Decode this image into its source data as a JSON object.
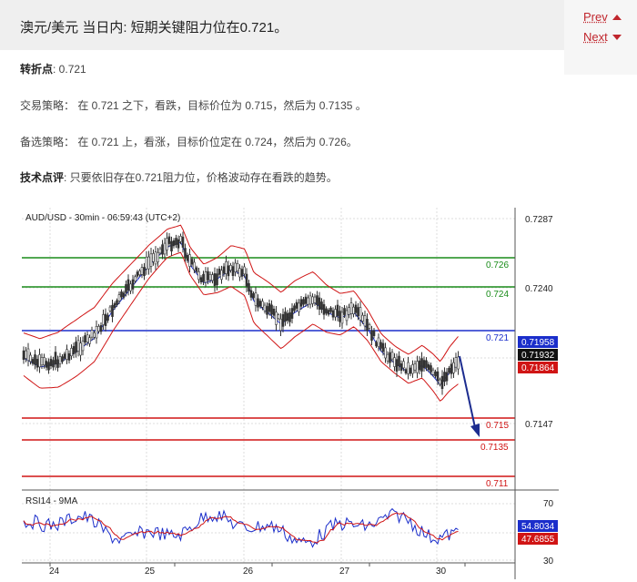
{
  "header": {
    "title": "澳元/美元 当日内: 短期关键阻力位在0.721。"
  },
  "nav": {
    "prev": "Prev",
    "next": "Next"
  },
  "content": {
    "pivot_label": "转折点",
    "pivot_value": ": 0.721",
    "strategy_label": "交易策略",
    "strategy_text": "： 在 0.721 之下，看跌，目标价位为 0.715，然后为 0.7135 。",
    "alt_label": "备选策略",
    "alt_text": "： 在 0.721 上，看涨，目标价位定在 0.724，然后为 0.726。",
    "tech_label": "技术点评",
    "tech_text": ": 只要依旧存在0.721阻力位，价格波动存在看跌的趋势。"
  },
  "chart": {
    "caption": "AUD/USD - 30min - 06:59:43 (UTC+2)",
    "price_axis_ticks": [
      "0.7287",
      "0.7240",
      "0.7147"
    ],
    "level_labels": {
      "r2": "0.726",
      "r1": "0.724",
      "pivot": "0.721",
      "s1": "0.715",
      "s2": "0.7135",
      "s3": "0.711"
    },
    "price_badges": {
      "upper": "0.71958",
      "last": "0.71932",
      "lower": "0.71864"
    },
    "rsi_caption": "RSI14 - 9MA",
    "rsi_axis_ticks": [
      "70",
      "30"
    ],
    "rsi_badges": {
      "rsi": "54.8034",
      "ma": "47.6855"
    },
    "date_labels": [
      "24",
      "25",
      "26",
      "27",
      "30"
    ],
    "colors": {
      "resistance": "#1a8c1a",
      "pivot": "#1b2ecb",
      "support": "#d01515",
      "candle": "#333333",
      "band": "#d01515",
      "ma": "#1b2ecb",
      "arrow": "#1c2c8f"
    }
  }
}
